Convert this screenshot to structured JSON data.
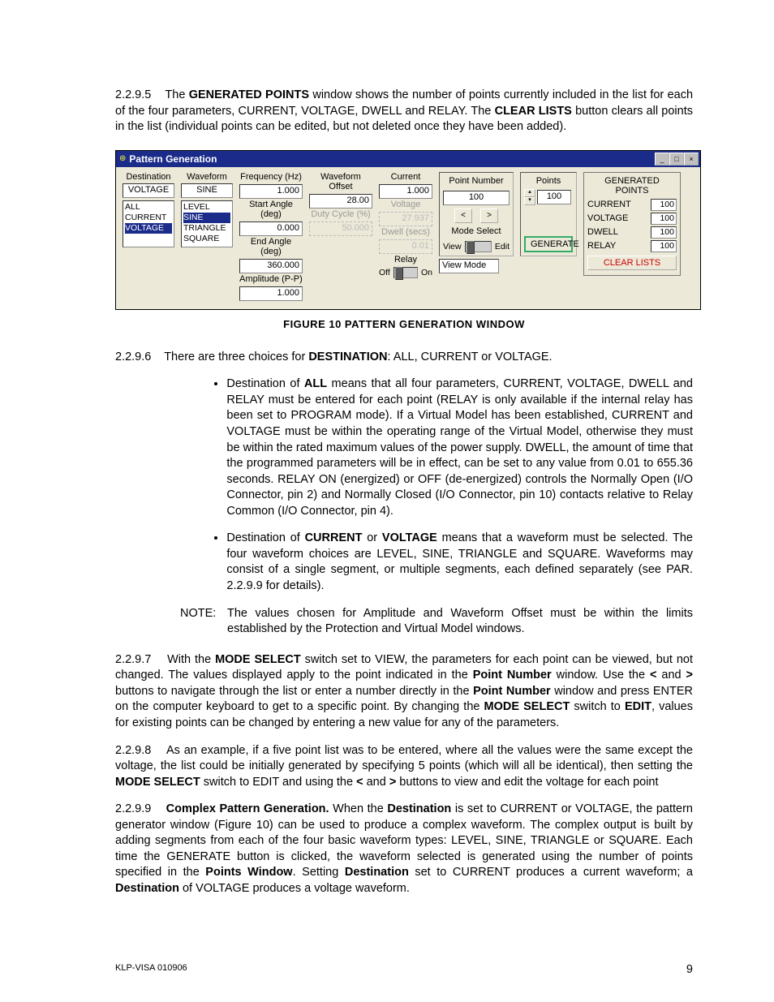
{
  "p2295": {
    "num": "2.2.9.5",
    "t1": "The ",
    "b1": "GENERATED POINTS",
    "t2": " window shows the number of points currently included in the list for each of the four parameters, CURRENT, VOLTAGE, DWELL and RELAY. The ",
    "b2": "CLEAR LISTS",
    "t3": " button clears all points in the list (individual points can be edited, but not deleted once they have been added)."
  },
  "win": {
    "title": "Pattern Generation",
    "dest_label": "Destination",
    "dest_selected": "VOLTAGE",
    "dest_opts": [
      "ALL",
      "CURRENT",
      "VOLTAGE"
    ],
    "wave_label": "Waveform",
    "wave_selected": "SINE",
    "wave_opts": [
      "LEVEL",
      "SINE",
      "TRIANGLE",
      "SQUARE"
    ],
    "freq_label": "Frequency (Hz)",
    "freq_val": "1.000",
    "startang_label": "Start Angle (deg)",
    "startang_val": "0.000",
    "endang_label": "End Angle (deg)",
    "endang_val": "360.000",
    "amp_label": "Amplitude (P-P)",
    "amp_val": "1.000",
    "woff_label": "Waveform Offset",
    "woff_val": "28.00",
    "duty_label": "Duty Cycle (%)",
    "duty_val": "50.000",
    "cur_label": "Current",
    "cur_val": "1.000",
    "volt_label": "Voltage",
    "volt_val": "27.937",
    "dwell_label": "Dwell (secs)",
    "dwell_val": "0.01",
    "relay_label": "Relay",
    "relay_off": "Off",
    "relay_on": "On",
    "pn_label": "Point Number",
    "pn_val": "100",
    "ms_label": "Mode Select",
    "ms_view": "View",
    "ms_edit": "Edit",
    "vm_label": "View Mode",
    "pts_label": "Points",
    "pts_val": "100",
    "gen_btn": "GENERATE",
    "gp_title": "GENERATED POINTS",
    "gp_rows": [
      {
        "k": "CURRENT",
        "v": "100"
      },
      {
        "k": "VOLTAGE",
        "v": "100"
      },
      {
        "k": "DWELL",
        "v": "100"
      },
      {
        "k": "RELAY",
        "v": "100"
      }
    ],
    "clear_btn": "CLEAR LISTS"
  },
  "fig_caption": "FIGURE 10  PATTERN GENERATION WINDOW",
  "p2296": {
    "num": "2.2.9.6",
    "t1": "There are three choices for ",
    "b1": "DESTINATION",
    "t2": ": ALL, CURRENT or VOLTAGE."
  },
  "bullet1": {
    "t1": "Destination of ",
    "b1": "ALL",
    "t2": " means that all four parameters, CURRENT, VOLTAGE, DWELL and RELAY must be entered for each point (RELAY is only available if the internal relay has been set to PROGRAM mode). If a Virtual Model has been established, CURRENT and VOLTAGE must be within the operating range of the Virtual Model, otherwise they must be within the rated maximum values of the power supply. DWELL, the amount of time that the programmed parameters will be in effect, can be set to any value from 0.01 to 655.36 seconds. RELAY ON (energized) or OFF (de-energized) controls the Normally Open (I/O Connector, pin 2) and Normally Closed (I/O Connector, pin 10) contacts relative to Relay Common (I/O Connector, pin 4)."
  },
  "bullet2": {
    "t1": "Destination of ",
    "b1": "CURRENT",
    "t2": " or ",
    "b2": "VOLTAGE",
    "t3": " means that a waveform must be selected. The four waveform choices are LEVEL, SINE, TRIANGLE and SQUARE. Waveforms may consist of a single segment, or multiple segments, each defined separately (see PAR. 2.2.9.9 for details)."
  },
  "note": {
    "label": "NOTE:",
    "text": "The values chosen for Amplitude and Waveform Offset must be within the limits established by the Protection and Virtual Model windows."
  },
  "p2297": {
    "num": "2.2.9.7",
    "t1": "With the ",
    "b1": "MODE SELECT",
    "t2": " switch set to VIEW, the parameters for each point can be viewed, but not changed. The values displayed apply to the point indicated in the ",
    "b2": "Point Number",
    "t3": " window. Use the ",
    "b3": "<",
    "t4": " and ",
    "b4": ">",
    "t5": " buttons to navigate through the list or enter a number directly in the ",
    "b5": "Point Number",
    "t6": " window and press ENTER on the computer keyboard to get to a specific point. By changing the ",
    "b6": "MODE SELECT",
    "t7": " switch to ",
    "b7": "EDIT",
    "t8": ", values for existing points can be changed by entering a new value for any of the parameters."
  },
  "p2298": {
    "num": "2.2.9.8",
    "t1": "As an example, if a five point list was to be entered, where all the values were the same except the voltage, the list could be initially generated by specifying 5 points (which will all be identical), then setting the ",
    "b1": "MODE SELECT",
    "t2": " switch to EDIT and using the ",
    "b2": "<",
    "t3": " and ",
    "b3": ">",
    "t4": " buttons to view and edit the voltage for each point"
  },
  "p2299": {
    "num": "2.2.9.9",
    "b0": "Complex Pattern Generation.",
    "t1": " When the ",
    "b1": "Destination",
    "t2": " is set to CURRENT or VOLTAGE, the pattern generator window (Figure 10) can be used to produce a complex waveform. The complex output is built by adding segments from each of the four basic waveform types: LEVEL, SINE, TRIANGLE or SQUARE. Each time the GENERATE button is clicked, the waveform selected is generated using the number of points specified in the ",
    "b2": "Points Window",
    "t3": ". Setting ",
    "b3": "Destination",
    "t4": " set to CURRENT produces a current waveform; a ",
    "b4": "Destination",
    "t5": " of VOLTAGE produces a voltage waveform."
  },
  "footer": {
    "left": "KLP-VISA 010906",
    "right": "9"
  }
}
